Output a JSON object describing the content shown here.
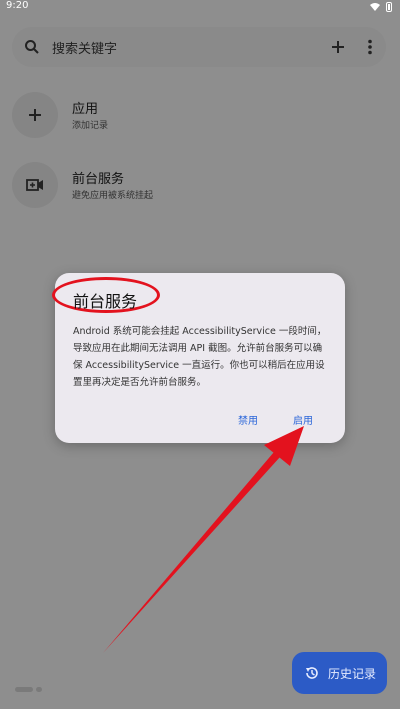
{
  "status_bar": {
    "time": "9:20"
  },
  "search": {
    "placeholder": "搜索关键字",
    "add_icon": "plus-icon",
    "more_icon": "more-vert-icon"
  },
  "list": {
    "items": [
      {
        "title": "应用",
        "subtitle": "添加记录",
        "icon": "plus-icon"
      },
      {
        "title": "前台服务",
        "subtitle": "避免应用被系统挂起",
        "icon": "video-call-icon"
      }
    ]
  },
  "dialog": {
    "title": "前台服务",
    "body": "Android 系统可能会挂起 AccessibilityService 一段时间，导致应用在此期间无法调用 API 截图。允许前台服务可以确保 AccessibilityService 一直运行。你也可以稍后在应用设置里再决定是否允许前台服务。",
    "disable_label": "禁用",
    "enable_label": "启用"
  },
  "fab": {
    "label": "历史记录",
    "icon": "history-icon"
  },
  "colors": {
    "accent": "#2b66d9",
    "fab": "#2c5bc6",
    "annotation": "#e3121e"
  }
}
